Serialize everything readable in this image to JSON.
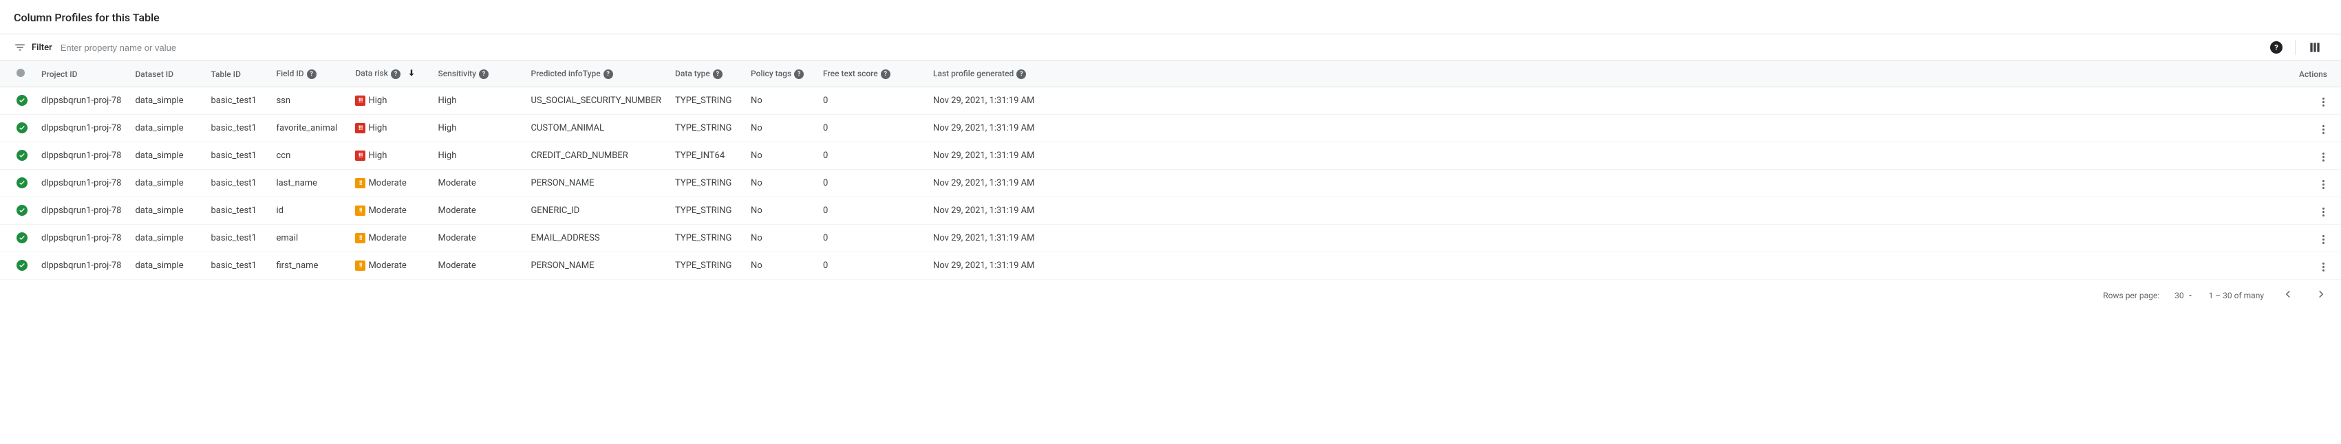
{
  "title": "Column Profiles for this Table",
  "filter": {
    "label": "Filter",
    "placeholder": "Enter property name or value"
  },
  "columns": {
    "project": "Project ID",
    "dataset": "Dataset ID",
    "table": "Table ID",
    "field": "Field ID",
    "risk": "Data risk",
    "sensitivity": "Sensitivity",
    "infotype": "Predicted infoType",
    "dtype": "Data type",
    "policy": "Policy tags",
    "free": "Free text score",
    "last": "Last profile generated",
    "actions": "Actions"
  },
  "rows": [
    {
      "project": "dlppsbqrun1-proj-78",
      "dataset": "data_simple",
      "table": "basic_test1",
      "field": "ssn",
      "risk": "High",
      "riskClass": "high",
      "sensitivity": "High",
      "infotype": "US_SOCIAL_SECURITY_NUMBER",
      "dtype": "TYPE_STRING",
      "policy": "No",
      "free": "0",
      "last": "Nov 29, 2021, 1:31:19 AM"
    },
    {
      "project": "dlppsbqrun1-proj-78",
      "dataset": "data_simple",
      "table": "basic_test1",
      "field": "favorite_animal",
      "risk": "High",
      "riskClass": "high",
      "sensitivity": "High",
      "infotype": "CUSTOM_ANIMAL",
      "dtype": "TYPE_STRING",
      "policy": "No",
      "free": "0",
      "last": "Nov 29, 2021, 1:31:19 AM"
    },
    {
      "project": "dlppsbqrun1-proj-78",
      "dataset": "data_simple",
      "table": "basic_test1",
      "field": "ccn",
      "risk": "High",
      "riskClass": "high",
      "sensitivity": "High",
      "infotype": "CREDIT_CARD_NUMBER",
      "dtype": "TYPE_INT64",
      "policy": "No",
      "free": "0",
      "last": "Nov 29, 2021, 1:31:19 AM"
    },
    {
      "project": "dlppsbqrun1-proj-78",
      "dataset": "data_simple",
      "table": "basic_test1",
      "field": "last_name",
      "risk": "Moderate",
      "riskClass": "moderate",
      "sensitivity": "Moderate",
      "infotype": "PERSON_NAME",
      "dtype": "TYPE_STRING",
      "policy": "No",
      "free": "0",
      "last": "Nov 29, 2021, 1:31:19 AM"
    },
    {
      "project": "dlppsbqrun1-proj-78",
      "dataset": "data_simple",
      "table": "basic_test1",
      "field": "id",
      "risk": "Moderate",
      "riskClass": "moderate",
      "sensitivity": "Moderate",
      "infotype": "GENERIC_ID",
      "dtype": "TYPE_STRING",
      "policy": "No",
      "free": "0",
      "last": "Nov 29, 2021, 1:31:19 AM"
    },
    {
      "project": "dlppsbqrun1-proj-78",
      "dataset": "data_simple",
      "table": "basic_test1",
      "field": "email",
      "risk": "Moderate",
      "riskClass": "moderate",
      "sensitivity": "Moderate",
      "infotype": "EMAIL_ADDRESS",
      "dtype": "TYPE_STRING",
      "policy": "No",
      "free": "0",
      "last": "Nov 29, 2021, 1:31:19 AM"
    },
    {
      "project": "dlppsbqrun1-proj-78",
      "dataset": "data_simple",
      "table": "basic_test1",
      "field": "first_name",
      "risk": "Moderate",
      "riskClass": "moderate",
      "sensitivity": "Moderate",
      "infotype": "PERSON_NAME",
      "dtype": "TYPE_STRING",
      "policy": "No",
      "free": "0",
      "last": "Nov 29, 2021, 1:31:19 AM"
    }
  ],
  "pagination": {
    "rpp_label": "Rows per page:",
    "rpp_value": "30",
    "range": "1 – 30 of many"
  }
}
